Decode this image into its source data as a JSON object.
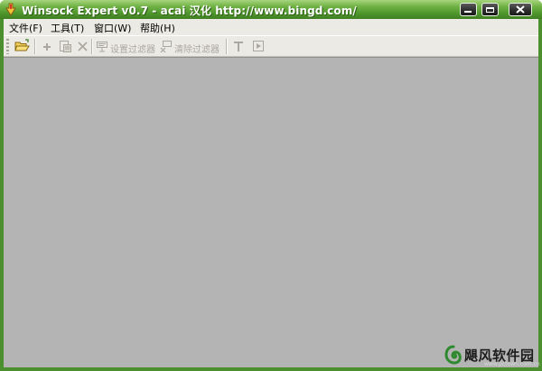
{
  "window": {
    "title": "Winsock Expert v0.7 - acai 汉化 http://www.bingd.com/",
    "controls": [
      "minimize",
      "maximize",
      "close"
    ]
  },
  "menubar": {
    "items": [
      {
        "label": "文件(F)",
        "mnemonic": "F"
      },
      {
        "label": "工具(T)",
        "mnemonic": "T"
      },
      {
        "label": "窗口(W)",
        "mnemonic": "W"
      },
      {
        "label": "帮助(H)",
        "mnemonic": "H"
      }
    ]
  },
  "toolbar": {
    "open_icon": "folder-open-icon",
    "add_icon": "plus-icon",
    "edit_icon": "packet-edit-icon",
    "delete_icon": "x-icon",
    "set_filter_label": "设置过滤器",
    "clear_filter_label": "清除过滤器",
    "text_icon": "t-icon",
    "play_icon": "play-icon",
    "disabled_text_color": "#a9a79e"
  },
  "watermark": {
    "text": "飓风软件园",
    "url": "www.pctown.com.cn"
  },
  "colors": {
    "titlebar": "#5da035",
    "frame": "#4b8f2e",
    "chrome": "#eceae4",
    "workspace": "#b4b4b4"
  }
}
